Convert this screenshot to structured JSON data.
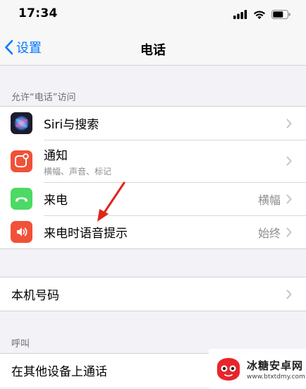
{
  "status_bar": {
    "time": "17:34"
  },
  "nav": {
    "back_label": "设置",
    "title": "电话"
  },
  "section_access": {
    "header": "允许“电话”访问",
    "items": [
      {
        "label": "Siri与搜索",
        "icon": "siri-icon"
      },
      {
        "label": "通知",
        "sublabel": "横幅、声音、标记",
        "icon": "notifications-icon"
      },
      {
        "label": "来电",
        "value": "横幅",
        "icon": "incoming-call-icon"
      },
      {
        "label": "来电时语音提示",
        "value": "始终",
        "icon": "announce-calls-icon"
      }
    ]
  },
  "section_number": {
    "items": [
      {
        "label": "本机号码"
      }
    ]
  },
  "section_calls": {
    "header": "呼叫",
    "items": [
      {
        "label": "在其他设备上通话"
      }
    ]
  },
  "watermark": {
    "title": "冰糖安卓网",
    "url": "www.btxtdmy.com"
  },
  "colors": {
    "accent": "#007aff",
    "background": "#f2f2f7",
    "notifications": "#f05138",
    "incoming_call": "#4cd964",
    "announce_calls": "#f05138"
  }
}
